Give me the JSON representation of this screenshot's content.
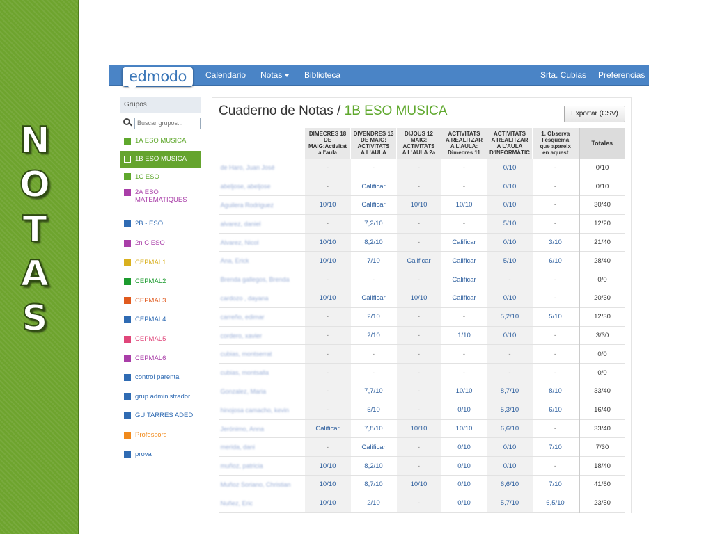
{
  "slide": {
    "side_title": [
      "N",
      "O",
      "T",
      "A",
      "S"
    ]
  },
  "nav": {
    "logo": "edmodo",
    "items": [
      "Calendario",
      "Notas",
      "Biblioteca"
    ],
    "user": "Srta. Cubias",
    "preferences": "Preferencias"
  },
  "sidebar": {
    "heading": "Grupos",
    "search_placeholder": "Buscar grupos...",
    "groups": [
      {
        "label": "1A ESO MUSICA",
        "color": "#5fa82d",
        "active": false
      },
      {
        "label": "1B ESO MUSICA",
        "color": "#5fa82d",
        "active": true
      },
      {
        "label": "1C ESO",
        "color": "#5fa82d",
        "active": false
      },
      {
        "label": "2A ESO\nMATEMATIQUES",
        "color": "#a93ea8",
        "active": false
      },
      {
        "label": "2B - ESO",
        "color": "#2f6bb3",
        "active": false
      },
      {
        "label": "2n C ESO",
        "color": "#a93ea8",
        "active": false
      },
      {
        "label": "CEPMAL1",
        "color": "#d9b01e",
        "active": false
      },
      {
        "label": "CEPMAL2",
        "color": "#1c9b2e",
        "active": false
      },
      {
        "label": "CEPMAL3",
        "color": "#e05a1e",
        "active": false
      },
      {
        "label": "CEPMAL4",
        "color": "#2f6bb3",
        "active": false
      },
      {
        "label": "CEPMAL5",
        "color": "#e0467a",
        "active": false
      },
      {
        "label": "CEPMAL6",
        "color": "#a93ea8",
        "active": false
      },
      {
        "label": "control parental",
        "color": "#2f6bb3",
        "active": false
      },
      {
        "label": "grup administrador",
        "color": "#2f6bb3",
        "active": false
      },
      {
        "label": "GUITARRES ADEDI",
        "color": "#2f6bb3",
        "active": false
      },
      {
        "label": "Professors",
        "color": "#f08a1c",
        "active": false
      },
      {
        "label": "prova",
        "color": "#2f6bb3",
        "active": false
      }
    ]
  },
  "gradebook": {
    "title_prefix": "Cuaderno de Notas /",
    "group_name": "1B ESO MUSICA",
    "export_label": "Exportar (CSV)",
    "columns": [
      "DIMECRES 18\nDE\nMAIG:Activitat\na l'aula",
      "DIVENDRES 13\nDE MAIG:\nACTIVITATS\nA L'AULA",
      "DIJOUS 12\nMAIG:\nACTIVITATS\nA L'AULA 2a",
      "ACTIVITATS\nA REALITZAR\nA L'AULA:\nDimecres 11",
      "ACTIVITATS\nA REALITZAR\nA L'AULA\nD'INFORMÀTIC",
      "1. Observa\nl'esquema\nque apareix\nen aquest"
    ],
    "totals_header": "Totales",
    "rows": [
      {
        "name": "de Haro, Juan José",
        "grades": [
          "-",
          "-",
          "-",
          "-",
          "0/10",
          "-"
        ],
        "total": "0/10"
      },
      {
        "name": "abeljose, abeljose",
        "grades": [
          "-",
          "Calificar",
          "-",
          "-",
          "0/10",
          "-"
        ],
        "total": "0/10"
      },
      {
        "name": "Aguilera Rodriguez",
        "grades": [
          "10/10",
          "Calificar",
          "10/10",
          "10/10",
          "0/10",
          "-"
        ],
        "total": "30/40"
      },
      {
        "name": "alvarez, daniel",
        "grades": [
          "-",
          "7,2/10",
          "-",
          "-",
          "5/10",
          "-"
        ],
        "total": "12/20"
      },
      {
        "name": "Alvarez, Nicol",
        "grades": [
          "10/10",
          "8,2/10",
          "-",
          "Calificar",
          "0/10",
          "3/10"
        ],
        "total": "21/40"
      },
      {
        "name": "Ana, Erick",
        "grades": [
          "10/10",
          "7/10",
          "Calificar",
          "Calificar",
          "5/10",
          "6/10"
        ],
        "total": "28/40"
      },
      {
        "name": "Brenda gallegos, Brenda",
        "grades": [
          "-",
          "-",
          "-",
          "Calificar",
          "-",
          "-"
        ],
        "total": "0/0"
      },
      {
        "name": "cardozo , dayana",
        "grades": [
          "10/10",
          "Calificar",
          "10/10",
          "Calificar",
          "0/10",
          "-"
        ],
        "total": "20/30"
      },
      {
        "name": "carreño, edimar",
        "grades": [
          "-",
          "2/10",
          "-",
          "-",
          "5,2/10",
          "5/10"
        ],
        "total": "12/30"
      },
      {
        "name": "cordero, xavier",
        "grades": [
          "-",
          "2/10",
          "-",
          "1/10",
          "0/10",
          "-"
        ],
        "total": "3/30"
      },
      {
        "name": "cubias, montserrat",
        "grades": [
          "-",
          "-",
          "-",
          "-",
          "-",
          "-"
        ],
        "total": "0/0"
      },
      {
        "name": "cubias, montsalla",
        "grades": [
          "-",
          "-",
          "-",
          "-",
          "-",
          "-"
        ],
        "total": "0/0"
      },
      {
        "name": "Gonzalez, Maria",
        "grades": [
          "-",
          "7,7/10",
          "-",
          "10/10",
          "8,7/10",
          "8/10"
        ],
        "total": "33/40"
      },
      {
        "name": "hinojosa camacho, kevin",
        "grades": [
          "-",
          "5/10",
          "-",
          "0/10",
          "5,3/10",
          "6/10"
        ],
        "total": "16/40"
      },
      {
        "name": "Jerónimo, Anna",
        "grades": [
          "Calificar",
          "7,8/10",
          "10/10",
          "10/10",
          "6,6/10",
          "-"
        ],
        "total": "33/40"
      },
      {
        "name": "merida, dani",
        "grades": [
          "-",
          "Calificar",
          "-",
          "0/10",
          "0/10",
          "7/10"
        ],
        "total": "7/30"
      },
      {
        "name": "muñoz, patricia",
        "grades": [
          "10/10",
          "8,2/10",
          "-",
          "0/10",
          "0/10",
          "-"
        ],
        "total": "18/40"
      },
      {
        "name": "Muñoz Soriano, Christian",
        "grades": [
          "10/10",
          "8,7/10",
          "10/10",
          "0/10",
          "6,6/10",
          "7/10"
        ],
        "total": "41/60"
      },
      {
        "name": "Nuñez, Eric",
        "grades": [
          "10/10",
          "2/10",
          "-",
          "0/10",
          "5,7/10",
          "6,5/10"
        ],
        "total": "23/50"
      }
    ]
  }
}
